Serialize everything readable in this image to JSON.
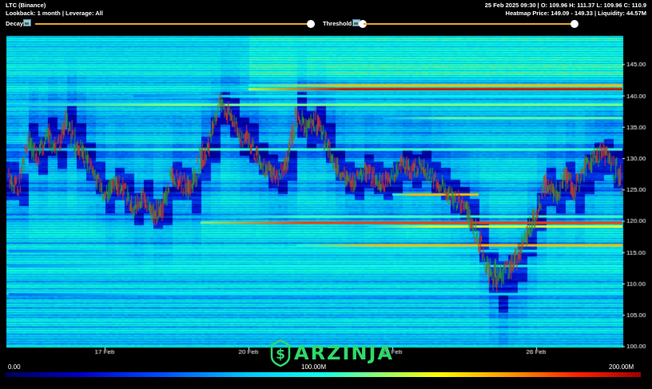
{
  "header": {
    "symbol": "LTC (Binance)",
    "settings": "Lookback: 1 month | Leverage: All",
    "ohlc": "25 Feb 2025 09:30 | O: 109.96 H: 111.37 L: 109.96 C: 110.9",
    "heatmap_info": "Heatmap Price: 149.09 - 149.33 | Liquidity: 44.57M"
  },
  "controls": {
    "decay_label": "Decay",
    "threshold_label": "Threshold",
    "decay_value": 1.0,
    "threshold_value": 1.0
  },
  "brand": {
    "name": "ARZINJA",
    "logo_icon": "dollar-s-icon"
  },
  "colors": {
    "background": "#000000",
    "slider_track": "#e6a630",
    "brand": "#2fd96b"
  },
  "colorbar": {
    "labels": [
      "0.00",
      "100.00M",
      "200.00M"
    ],
    "min": 0,
    "max": 200
  },
  "chart_data": {
    "type": "heatmap",
    "title": "",
    "xlabel": "",
    "ylabel": "",
    "x_ticks": [
      "17 Feb",
      "20 Feb",
      "23 Feb",
      "26 Feb"
    ],
    "x_tick_days": [
      17,
      20,
      23,
      26
    ],
    "x_range": [
      14.95,
      27.8
    ],
    "y_ticks": [
      100,
      105,
      110,
      115,
      120,
      125,
      130,
      135,
      140,
      145
    ],
    "ylim": [
      99.8,
      149.5
    ],
    "grid": false,
    "price_series": {
      "name": "",
      "x": [
        15.0,
        15.2,
        15.4,
        15.6,
        15.8,
        16.0,
        16.2,
        16.4,
        16.6,
        16.8,
        17.0,
        17.2,
        17.4,
        17.6,
        17.8,
        18.0,
        18.2,
        18.4,
        18.6,
        18.8,
        19.0,
        19.2,
        19.4,
        19.6,
        19.8,
        20.0,
        20.2,
        20.4,
        20.6,
        20.8,
        21.0,
        21.2,
        21.4,
        21.6,
        21.8,
        22.0,
        22.2,
        22.4,
        22.6,
        22.8,
        23.0,
        23.2,
        23.4,
        23.6,
        23.8,
        24.0,
        24.2,
        24.4,
        24.6,
        24.8,
        25.0,
        25.2,
        25.4,
        25.6,
        25.8,
        26.0,
        26.2,
        26.4,
        26.6,
        26.8,
        27.0,
        27.2,
        27.4,
        27.6,
        27.8
      ],
      "y": [
        127,
        125,
        133,
        130,
        134,
        131,
        136,
        132,
        130,
        127,
        124,
        126,
        125,
        122,
        124,
        121,
        122,
        127,
        126,
        125,
        130,
        133,
        139,
        137,
        134,
        133,
        130,
        128,
        127,
        129,
        137,
        135,
        136,
        133,
        129,
        127,
        126,
        128,
        127,
        126,
        127,
        129,
        128,
        129,
        127,
        126,
        124,
        123,
        121,
        117,
        112,
        111,
        112,
        114,
        118,
        121,
        126,
        124,
        127,
        125,
        128,
        130,
        131,
        129,
        126
      ],
      "high": [
        129,
        127,
        135,
        133,
        136,
        134,
        138,
        135,
        132,
        129,
        126,
        128,
        127,
        124,
        126,
        123,
        125,
        129,
        128,
        127,
        133,
        136,
        140,
        139,
        136,
        135,
        132,
        130,
        129,
        131,
        140,
        137,
        138,
        135,
        131,
        129,
        128,
        130,
        129,
        128,
        129,
        131,
        130,
        131,
        129,
        128,
        126,
        125,
        123,
        119,
        115,
        113,
        114,
        116,
        120,
        124,
        128,
        126,
        129,
        127,
        130,
        132,
        132.5,
        131,
        128
      ],
      "low": [
        124,
        123,
        130,
        128,
        131,
        129,
        133,
        129,
        127,
        125,
        122,
        124,
        122,
        120,
        122,
        119.5,
        120,
        124,
        124,
        122,
        127,
        130,
        136,
        134,
        131,
        130,
        128,
        126,
        125,
        127,
        134,
        132,
        133,
        130,
        127,
        125,
        124,
        126,
        125,
        124,
        125,
        127,
        126,
        127,
        125,
        124,
        122,
        121,
        119,
        114,
        109,
        106,
        109,
        111,
        115,
        119,
        123,
        122,
        124,
        122,
        125,
        127,
        128,
        126,
        122
      ]
    },
    "liquidity_bands": [
      {
        "price": 141.0,
        "x_start": 20.0,
        "x_end": 27.8,
        "value": 190
      },
      {
        "price": 141.6,
        "x_start": 20.0,
        "x_end": 27.8,
        "value": 150
      },
      {
        "price": 139.9,
        "x_start": 17.6,
        "x_end": 27.8,
        "value": 95
      },
      {
        "price": 138.5,
        "x_start": 15.0,
        "x_end": 27.8,
        "value": 115
      },
      {
        "price": 136.4,
        "x_start": 22.8,
        "x_end": 27.8,
        "value": 110
      },
      {
        "price": 131.4,
        "x_start": 15.0,
        "x_end": 27.8,
        "value": 105
      },
      {
        "price": 124.2,
        "x_start": 23.0,
        "x_end": 24.8,
        "value": 150
      },
      {
        "price": 120.7,
        "x_start": 19.0,
        "x_end": 27.8,
        "value": 105
      },
      {
        "price": 119.7,
        "x_start": 19.0,
        "x_end": 27.8,
        "value": 175
      },
      {
        "price": 119.1,
        "x_start": 22.5,
        "x_end": 27.8,
        "value": 130
      },
      {
        "price": 116.1,
        "x_start": 21.0,
        "x_end": 27.8,
        "value": 150
      },
      {
        "price": 115.2,
        "x_start": 15.0,
        "x_end": 27.8,
        "value": 90
      },
      {
        "price": 112.8,
        "x_start": 15.0,
        "x_end": 27.8,
        "value": 100
      },
      {
        "price": 108.3,
        "x_start": 15.0,
        "x_end": 27.8,
        "value": 85
      }
    ]
  }
}
